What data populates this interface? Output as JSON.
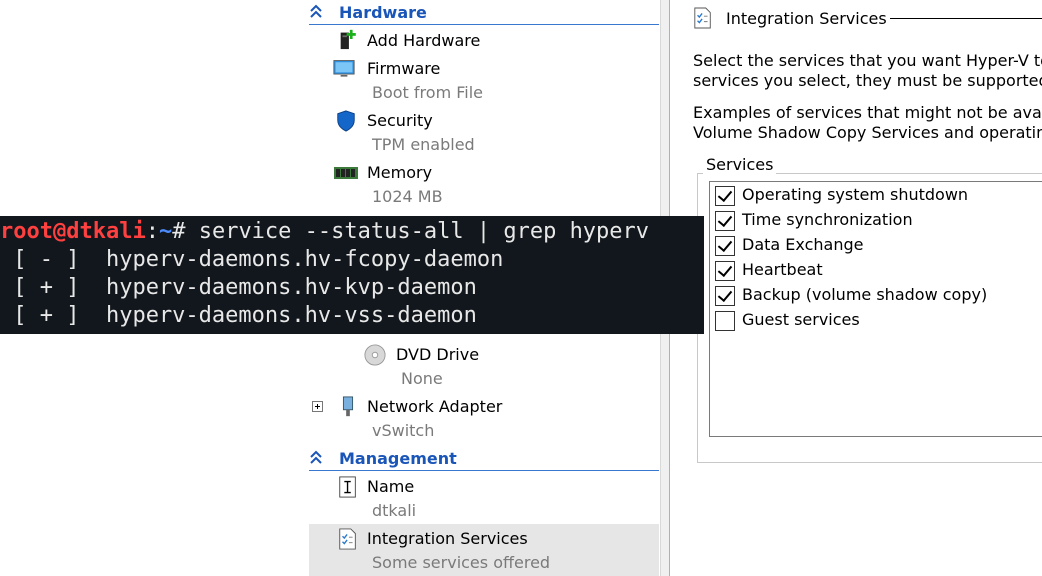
{
  "nav": {
    "hardware": {
      "title": "Hardware",
      "items": [
        {
          "label": "Add Hardware",
          "sub": ""
        },
        {
          "label": "Firmware",
          "sub": "Boot from File"
        },
        {
          "label": "Security",
          "sub": "TPM enabled"
        },
        {
          "label": "Memory",
          "sub": "1024 MB"
        },
        {
          "label": "DVD Drive",
          "sub": "None"
        },
        {
          "label": "Network Adapter",
          "sub": "vSwitch"
        }
      ]
    },
    "management": {
      "title": "Management",
      "items": [
        {
          "label": "Name",
          "sub": "dtkali"
        },
        {
          "label": "Integration Services",
          "sub": "Some services offered"
        }
      ]
    }
  },
  "panel": {
    "title": "Integration Services",
    "paragraph1": [
      "Select the services that you want Hyper-V to o",
      "services you select, they must be supported b"
    ],
    "paragraph2": [
      "Examples of services that might not be availab",
      "Volume Shadow Copy Services and operating s"
    ],
    "services_group_label": "Services",
    "services": [
      {
        "label": "Operating system shutdown",
        "checked": true
      },
      {
        "label": "Time synchronization",
        "checked": true
      },
      {
        "label": "Data Exchange",
        "checked": true
      },
      {
        "label": "Heartbeat",
        "checked": true
      },
      {
        "label": "Backup (volume shadow copy)",
        "checked": true
      },
      {
        "label": "Guest services",
        "checked": false
      }
    ]
  },
  "terminal": {
    "user_host": "root@dtkali",
    "colon": ":",
    "path": "~",
    "prompt_symbol": "# ",
    "command": "service --status-all | grep hyperv",
    "output": [
      " [ - ]  hyperv-daemons.hv-fcopy-daemon",
      " [ + ]  hyperv-daemons.hv-kvp-daemon",
      " [ + ]  hyperv-daemons.hv-vss-daemon"
    ]
  },
  "colors": {
    "section_header": "#1a55b8",
    "terminal_bg": "#11171c",
    "terminal_user": "#ff4040",
    "terminal_path": "#4d8cff"
  }
}
